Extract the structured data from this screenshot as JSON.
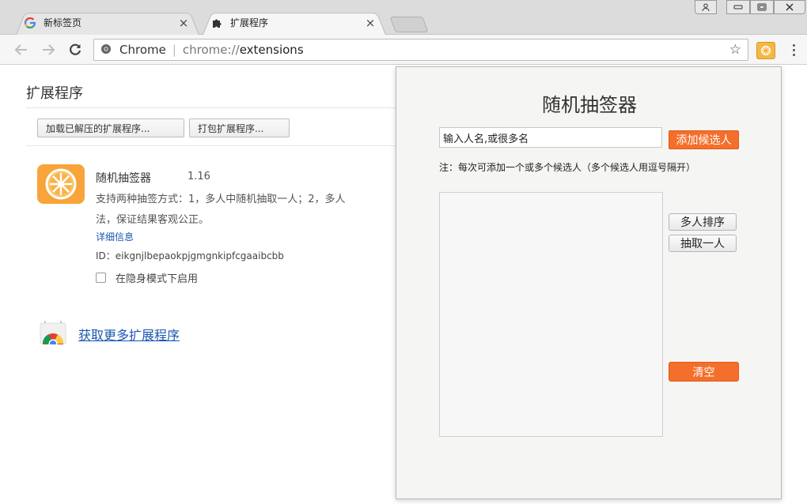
{
  "tabs": [
    {
      "title": "新标签页",
      "close": "×",
      "icon": "google-g-icon"
    },
    {
      "title": "扩展程序",
      "close": "×",
      "icon": "puzzle-icon"
    }
  ],
  "toolbar": {
    "site_name": "Chrome",
    "url_scheme": "chrome://",
    "url_host": "extensions"
  },
  "page": {
    "title": "扩展程序",
    "load_unpacked": "加载已解压的扩展程序...",
    "pack": "打包扩展程序..."
  },
  "extension": {
    "name": "随机抽签器",
    "version": "1.16",
    "desc_line1": "支持两种抽签方式：1，多人中随机抽取一人；2，多人",
    "desc_line2": "法，保证结果客观公正。",
    "details": "详细信息",
    "id_label": "ID：",
    "id": "eikgnjlbepaokpjgmgnkipfcgaaibcbb",
    "incognito": "在隐身模式下启用",
    "icon_color": "#f8a43a"
  },
  "store_link": "获取更多扩展程序",
  "popup": {
    "title": "随机抽签器",
    "input_value": "输入人名,或很多名",
    "add_button": "添加候选人",
    "note": "注：每次可添加一个或多个候选人（多个候选人用逗号隔开）",
    "sort_button": "多人排序",
    "pick_button": "抽取一人",
    "clear_button": "清空",
    "accent": "#f46f2c"
  }
}
